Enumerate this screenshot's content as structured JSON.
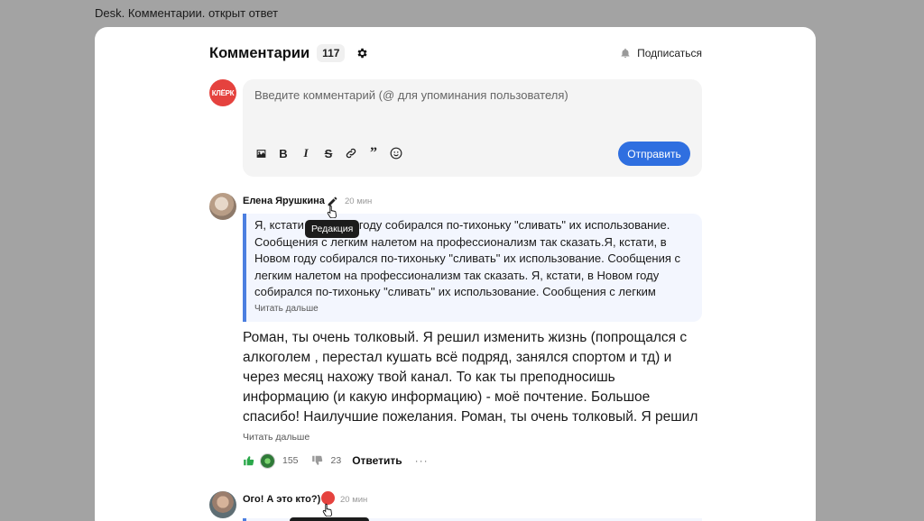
{
  "frame_title": "Desk. Комментарии. открыт ответ",
  "header": {
    "title": "Комментарии",
    "count": "117",
    "subscribe_label": "Подписаться"
  },
  "compose": {
    "avatar_text": "КЛЁРК",
    "placeholder": "Введите комментарий (@ для упоминания пользователя)",
    "send_label": "Отправить",
    "tools": [
      "image-icon",
      "bold-icon",
      "italic-icon",
      "strikethrough-icon",
      "link-icon",
      "quote-icon",
      "emoji-icon"
    ]
  },
  "comments": [
    {
      "author": "Елена Ярушкина",
      "time": "20 мин",
      "tooltip": "Редакция",
      "quote": "Я, кстати, в Новом году собирался по-тихоньку \"сливать\" их использование. Сообщения с легким налетом на профессионализм так сказать.Я, кстати, в Новом году собирался по-тихоньку \"сливать\" их использование. Сообщения с легким налетом на профессионализм так сказать. Я, кстати, в Новом году собирался по-тихоньку \"сливать\" их использование. Сообщения с легким налетом на професси…",
      "quote_more": "Читать дальше",
      "body": "Роман, ты очень толковый. Я решил изменить жизнь (попрощался с алкоголем , перестал кушать всё подряд, занялся спортом и тд) и через месяц нахожу твой канал. То как ты преподносишь информацию (и какую информацию) - моё почтение. Большое спасибо! Наилучшие пожелания. Роман, ты очень толковый. Я решил изменить жизнь (попрощался с алког…",
      "body_more": "Читать дальше",
      "likes": "155",
      "dislikes": "23",
      "reply_label": "Ответить",
      "more_label": "···"
    },
    {
      "author": "Ого! А это кто?)",
      "time": "20 мин"
    }
  ]
}
